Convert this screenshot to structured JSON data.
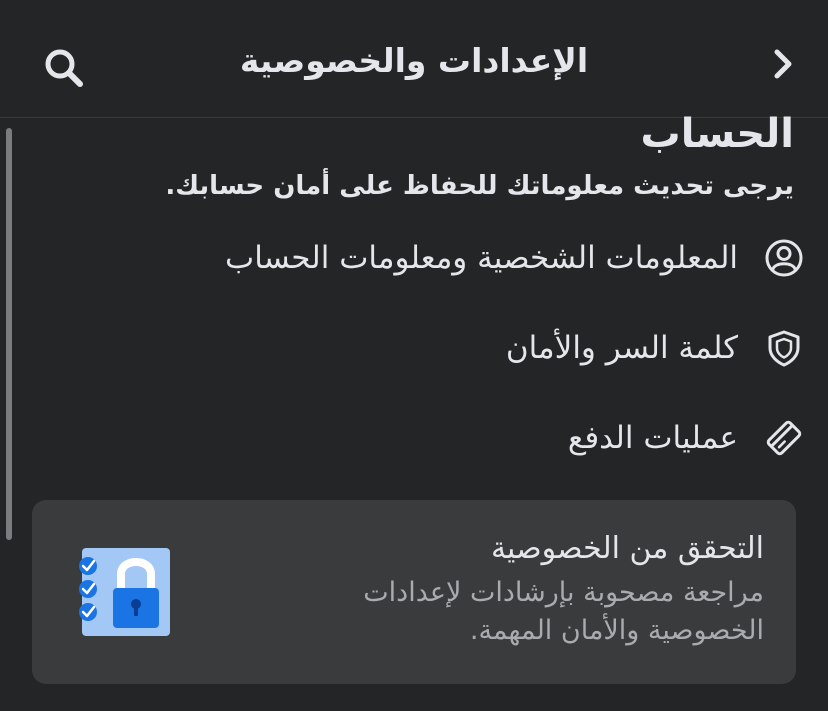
{
  "header": {
    "title": "الإعدادات والخصوصية",
    "back_icon": "chevron-right-icon",
    "search_icon": "search-icon"
  },
  "account": {
    "title": "الحساب",
    "subtitle": "يرجى تحديث معلوماتك للحفاظ على أمان حسابك.",
    "items": [
      {
        "label": "المعلومات الشخصية ومعلومات الحساب",
        "icon": "user-circle-icon"
      },
      {
        "label": "كلمة السر والأمان",
        "icon": "shield-icon"
      },
      {
        "label": "عمليات الدفع",
        "icon": "payment-card-icon"
      }
    ]
  },
  "privacy_card": {
    "title": "التحقق من الخصوصية",
    "description": "مراجعة مصحوبة بإرشادات لإعدادات الخصوصية والأمان المهمة.",
    "illustration": "checklist-lock-icon"
  },
  "colors": {
    "background": "#242526",
    "card": "#3a3b3c",
    "text_primary": "#e4e6eb",
    "text_secondary": "#a8abaf",
    "accent_blue": "#1b74e4"
  }
}
